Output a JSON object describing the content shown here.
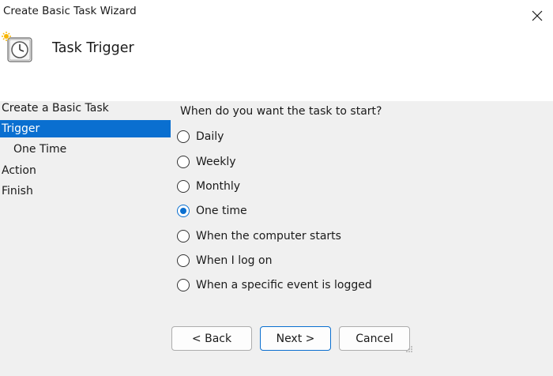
{
  "window": {
    "title": "Create Basic Task Wizard"
  },
  "header": {
    "title": "Task Trigger",
    "icon": "task-scheduler-clock-icon"
  },
  "sidebar": {
    "steps": [
      {
        "label": "Create a Basic Task",
        "selected": false
      },
      {
        "label": "Trigger",
        "selected": true
      },
      {
        "label": "One Time",
        "selected": false
      },
      {
        "label": "Action",
        "selected": false
      },
      {
        "label": "Finish",
        "selected": false
      }
    ]
  },
  "main": {
    "question": "When do you want the task to start?",
    "options": [
      {
        "label": "Daily",
        "checked": false
      },
      {
        "label": "Weekly",
        "checked": false
      },
      {
        "label": "Monthly",
        "checked": false
      },
      {
        "label": "One time",
        "checked": true
      },
      {
        "label": "When the computer starts",
        "checked": false
      },
      {
        "label": "When I log on",
        "checked": false
      },
      {
        "label": "When a specific event is logged",
        "checked": false
      }
    ]
  },
  "buttons": {
    "back": "< Back",
    "next": "Next >",
    "cancel": "Cancel"
  },
  "colors": {
    "accent": "#0a6fd0",
    "panel": "#f0f0f0",
    "header": "#ffffff"
  }
}
